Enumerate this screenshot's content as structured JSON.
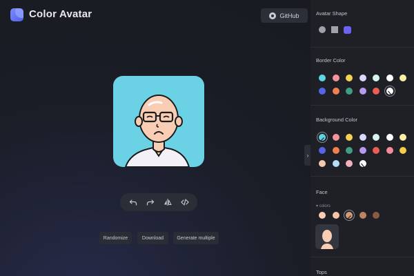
{
  "header": {
    "title": "Color Avatar",
    "github_label": "GitHub"
  },
  "actions": {
    "randomize": "Randomize",
    "download": "Download",
    "generate_multiple": "Generate multiple"
  },
  "toolbar_icons": [
    "undo-icon",
    "redo-icon",
    "flip-icon",
    "code-icon"
  ],
  "panel": {
    "avatar_shape": {
      "title": "Avatar Shape",
      "options": [
        "circle",
        "square",
        "squircle"
      ],
      "selected": "squircle"
    },
    "border_color": {
      "title": "Border Color",
      "colors": [
        "#5fd4e5",
        "#f4929e",
        "#f7d154",
        "#d7d9ff",
        "#d6f6f0",
        "#ffffff",
        "#fff0a8",
        "#5565e8",
        "#f0814f",
        "#3f9e84",
        "#b69af0",
        "#ee5d52",
        "transparent"
      ],
      "selected": "transparent"
    },
    "background_color": {
      "title": "Background Color",
      "colors": [
        "#5fd4e5",
        "#f4929e",
        "#f7d154",
        "#d7d9ff",
        "#d6f6f0",
        "#ffffff",
        "#fff0a8",
        "#5565e8",
        "#f0814f",
        "#3f9e84",
        "#b69af0",
        "#ee5d52",
        "#f58a9a",
        "#f7cd4a",
        "#f7c7b0",
        "#b8dcf5",
        "#f3b0bc",
        "transparent"
      ],
      "selected": "#5fd4e5"
    },
    "face": {
      "title": "Face",
      "sub_label": "colors",
      "colors": [
        "#f8cdb3",
        "#f3c4a8",
        "#d49a76",
        "#bb8462",
        "#8b5a40"
      ],
      "selected": "#d49a76"
    },
    "tops": {
      "title": "Tops"
    }
  }
}
